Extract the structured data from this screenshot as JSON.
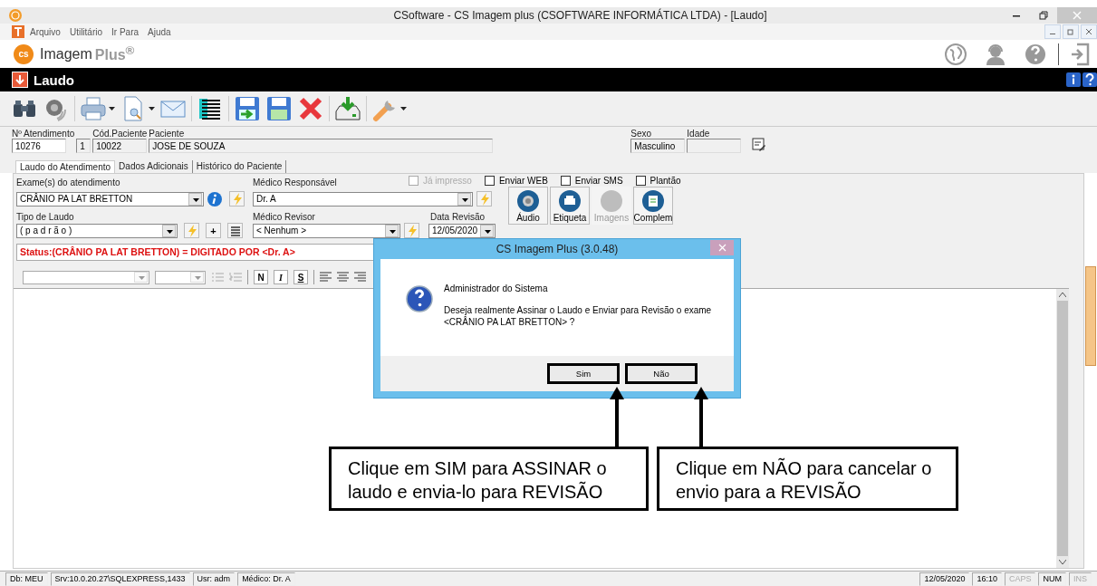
{
  "window": {
    "title": "CSoftware - CS Imagem plus (CSOFTWARE INFORMÁTICA LTDA) - [Laudo]"
  },
  "menu": [
    "Arquivo",
    "Utilitário",
    "Ir Para",
    "Ajuda"
  ],
  "brand": {
    "name": "Imagem",
    "suffix": "Plus$^{®}$",
    "mark": "cs"
  },
  "form_title": "Laudo",
  "patient_fields": [
    {
      "label": "Nº Atendimento",
      "value": "10276",
      "kind": "wide"
    },
    {
      "value": "1",
      "kind": "tiny"
    },
    {
      "label": "Cód.Paciente",
      "value": "10022",
      "kind": "mid"
    },
    {
      "label": "Paciente",
      "value": "JOSE DE SOUZA",
      "kind": "long"
    },
    {
      "label": "Sexo",
      "value": "Masculino",
      "kind": "mid"
    },
    {
      "label": "Idade",
      "kind": "mid"
    }
  ],
  "tabs": [
    {
      "label": "Laudo do Atendimento",
      "selected": true
    },
    {
      "label": "Dados Adicionais",
      "selected": false
    },
    {
      "label": "Histórico do Paciente",
      "selected": false
    }
  ],
  "options": [
    {
      "label": "Já impresso",
      "checked": false,
      "disabled": true
    },
    {
      "label": "Enviar WEB",
      "checked": false,
      "disabled": false
    },
    {
      "label": "Enviar SMS",
      "checked": false,
      "disabled": false
    },
    {
      "label": "Plantão",
      "checked": false,
      "disabled": false
    }
  ],
  "exam": {
    "label": "Exame(s) do atendimento",
    "value": "CRÂNIO PA LAT BRETTON"
  },
  "responsible": {
    "label": "Médico Responsável",
    "value": "Dr. A"
  },
  "report_type": {
    "label": "Tipo de Laudo",
    "value": "( p a d r ã o )",
    "add": "+"
  },
  "reviewer": {
    "label": "Médico Revisor",
    "value": "< Nenhum >"
  },
  "review_date": {
    "label": "Data Revisão",
    "value": "12/05/2020"
  },
  "media_buttons": [
    {
      "label": "Áudio",
      "disabled": false,
      "kind": "audio"
    },
    {
      "label": "Etiqueta",
      "disabled": false,
      "kind": "printer"
    },
    {
      "label": "Imagens",
      "disabled": true,
      "kind": "images"
    },
    {
      "label": "Complem",
      "disabled": false,
      "kind": "note"
    }
  ],
  "status_line": "Status:(CRÂNIO PA LAT BRETTON) = DIGITADO POR <Dr. A>",
  "format_buttons": [
    "N",
    "I",
    "S"
  ],
  "dialog": {
    "title": "CS Imagem Plus (3.0.48)",
    "heading": "Administrador do Sistema",
    "message": [
      "Deseja realmente Assinar o Laudo e Enviar para Revisão o exame",
      "<CRÂNIO PA LAT BRETTON> ?"
    ],
    "buttons": [
      "Sim",
      "Não"
    ]
  },
  "callouts": [
    "Clique em SIM para ASSINAR o laudo e envia-lo para REVISÃO",
    "Clique em NÃO para cancelar o envio para a REVISÃO"
  ],
  "status_bar": {
    "left": [
      {
        "text": "Db: MEU",
        "disabled": false
      },
      {
        "text": "Srv:10.0.20.27\\SQLEXPRESS,1433",
        "disabled": false
      },
      {
        "text": "Usr: adm",
        "disabled": false
      },
      {
        "text": "Médico: Dr. A",
        "disabled": false
      }
    ],
    "right": [
      {
        "text": "12/05/2020",
        "disabled": false
      },
      {
        "text": "16:10",
        "disabled": false
      },
      {
        "text": "CAPS",
        "disabled": true
      },
      {
        "text": "NUM",
        "disabled": false
      },
      {
        "text": "INS",
        "disabled": true
      }
    ]
  }
}
